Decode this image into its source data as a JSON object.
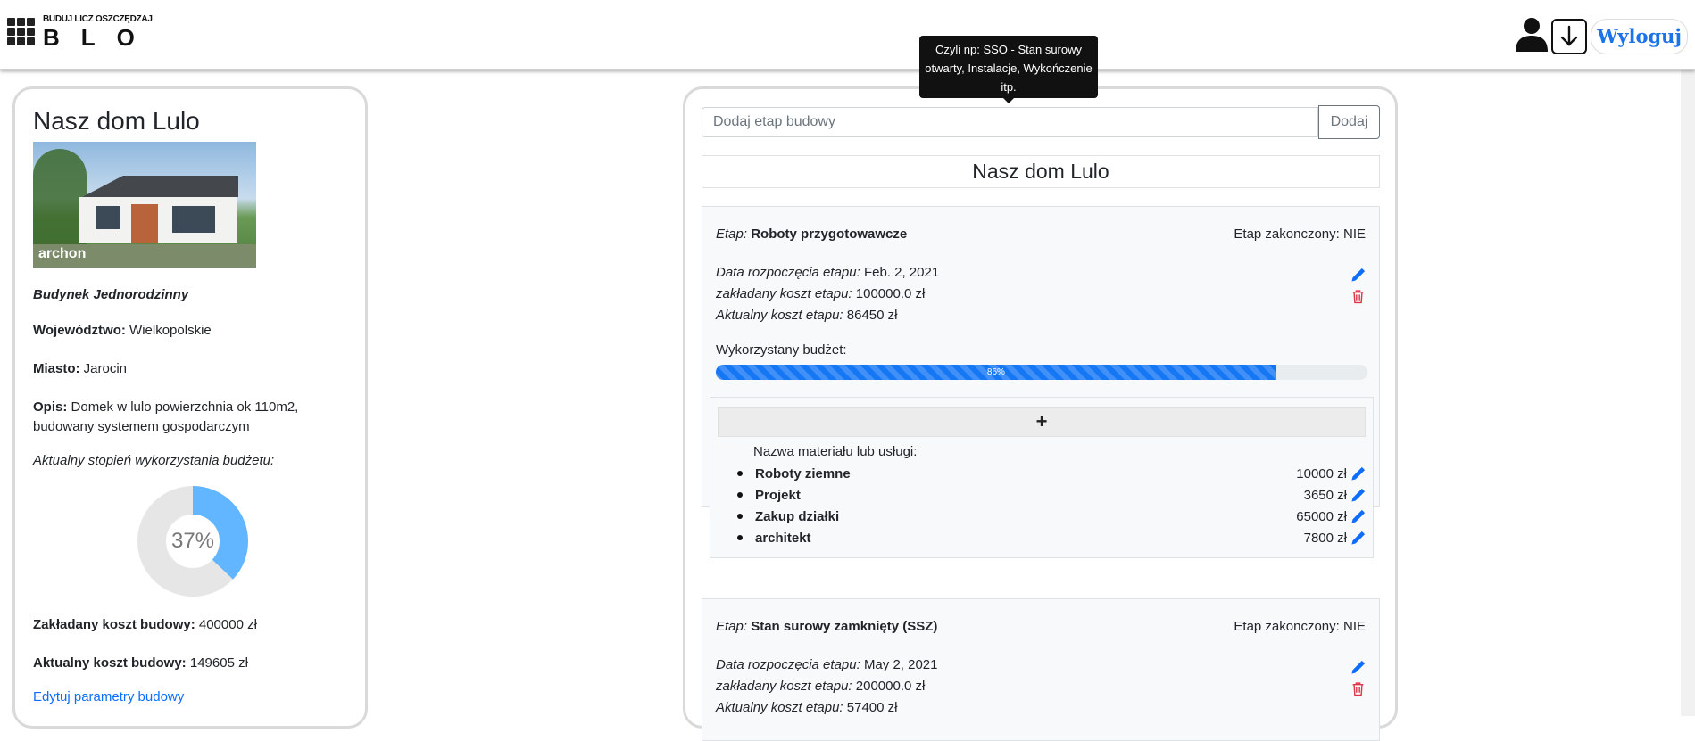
{
  "navbar": {
    "logo_tagline": "BUDUJ LICZ OSZCZĘDZAJ",
    "logo_big": "BLO",
    "logout_label": "Wyloguj"
  },
  "tooltip": {
    "text": "Czyli np: SSO - Stan surowy otwarty, Instalacje, Wykończenie itp."
  },
  "project": {
    "name": "Nasz dom Lulo",
    "image_brand": "archon",
    "type": "Budynek Jednorodzinny",
    "voivodeship_label": "Województwo:",
    "voivodeship": "Wielkopolskie",
    "city_label": "Miasto:",
    "city": "Jarocin",
    "description_label": "Opis:",
    "description": "Domek w lulo powierzchnia ok 110m2, budowany systemem gospodarczym",
    "budget_usage_label": "Aktualny stopień wykorzystania budżetu:",
    "budget_usage_percent": 37,
    "budget_usage_text": "37%",
    "planned_cost_label": "Zakładany koszt budowy:",
    "planned_cost": "400000 zł",
    "actual_cost_label": "Aktualny koszt budowy:",
    "actual_cost": "149605 zł",
    "edit_link": "Edytuj parametry budowy"
  },
  "main": {
    "add_stage_placeholder": "Dodaj etap budowy",
    "add_stage_button": "Dodaj",
    "title": "Nasz dom Lulo",
    "stages": [
      {
        "stage_label": "Etap:",
        "name": "Roboty przygotowawcze",
        "finished_label": "Etap zakonczony:",
        "finished": "NIE",
        "start_label": "Data rozpoczęcia etapu:",
        "start": "Feb. 2, 2021",
        "planned_label": "zakładany koszt etapu:",
        "planned": "100000.0 zł",
        "actual_label": "Aktualny koszt etapu:",
        "actual": "86450 zł",
        "budget_label": "Wykorzystany budżet:",
        "progress_percent": 86,
        "progress_text": "86%",
        "materials_plus": "+",
        "materials_header": "Nazwa materiału lub usługi:",
        "materials": [
          {
            "name": "Roboty ziemne",
            "price": "10000 zł"
          },
          {
            "name": "Projekt",
            "price": "3650 zł"
          },
          {
            "name": "Zakup działki",
            "price": "65000 zł"
          },
          {
            "name": "architekt",
            "price": "7800 zł"
          }
        ]
      },
      {
        "stage_label": "Etap:",
        "name": "Stan surowy zamknięty (SSZ)",
        "finished_label": "Etap zakonczony:",
        "finished": "NIE",
        "start_label": "Data rozpoczęcia etapu:",
        "start": "May 2, 2021",
        "planned_label": "zakładany koszt etapu:",
        "planned": "200000.0 zł",
        "actual_label": "Aktualny koszt etapu:",
        "actual": "57400 zł"
      }
    ]
  },
  "colors": {
    "accent": "#0d6efd",
    "progress": "#1677f5",
    "donut_fill": "#62b5ff",
    "donut_rest": "#e6e6e6",
    "delete": "#dc3545"
  },
  "icons": [
    "user-icon",
    "download-icon",
    "pencil-icon",
    "trash-icon",
    "plus-icon"
  ]
}
